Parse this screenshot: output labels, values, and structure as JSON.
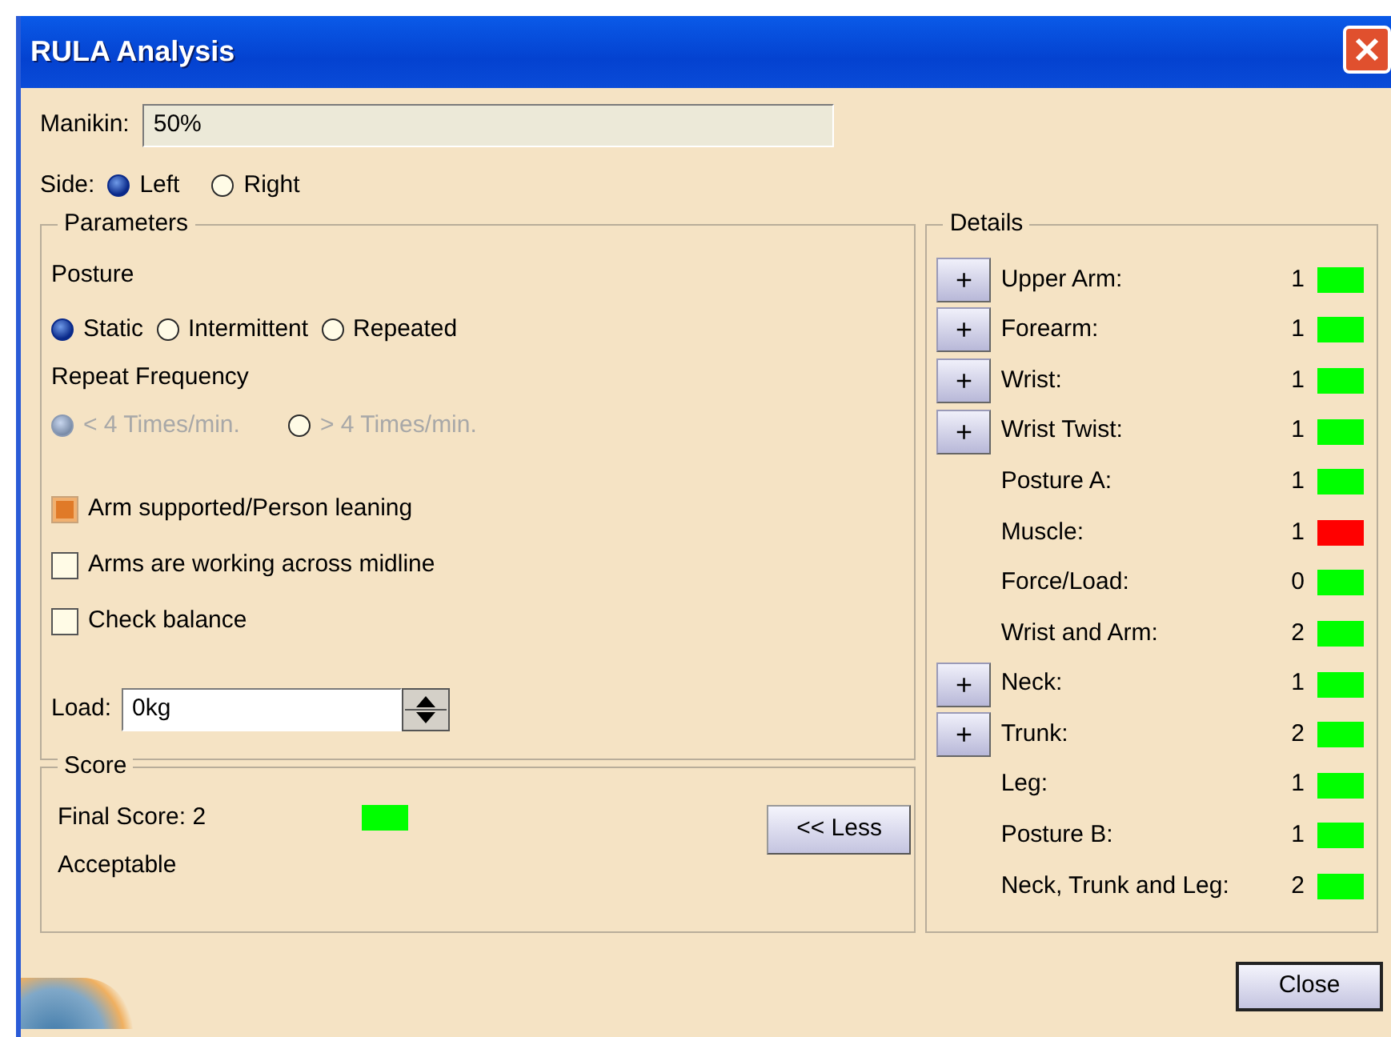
{
  "window": {
    "title": "RULA Analysis"
  },
  "manikin": {
    "label": "Manikin:",
    "value": "50%"
  },
  "side": {
    "label": "Side:",
    "options": [
      {
        "label": "Left",
        "selected": true
      },
      {
        "label": "Right",
        "selected": false
      }
    ]
  },
  "parameters": {
    "title": "Parameters",
    "posture": {
      "label": "Posture",
      "options": [
        {
          "label": "Static",
          "selected": true
        },
        {
          "label": "Intermittent",
          "selected": false
        },
        {
          "label": "Repeated",
          "selected": false
        }
      ]
    },
    "repeat_frequency": {
      "label": "Repeat Frequency",
      "disabled": true,
      "options": [
        {
          "label": "< 4 Times/min.",
          "selected": true
        },
        {
          "label": "> 4 Times/min.",
          "selected": false
        }
      ]
    },
    "checkboxes": [
      {
        "label": "Arm supported/Person leaning",
        "checked": true
      },
      {
        "label": "Arms are working across midline",
        "checked": false
      },
      {
        "label": "Check balance",
        "checked": false
      }
    ],
    "load": {
      "label": "Load:",
      "value": "0kg"
    }
  },
  "score": {
    "title": "Score",
    "final_score": "Final Score: 2",
    "color": "#00ff00",
    "verdict": "Acceptable",
    "less_button": "<< Less"
  },
  "details": {
    "title": "Details",
    "rows": [
      {
        "label": "Upper Arm:",
        "value": "1",
        "color": "#00ff00",
        "button": "+"
      },
      {
        "label": "Forearm:",
        "value": "1",
        "color": "#00ff00",
        "button": "+"
      },
      {
        "label": "Wrist:",
        "value": "1",
        "color": "#00ff00",
        "button": "+"
      },
      {
        "label": "Wrist Twist:",
        "value": "1",
        "color": "#00ff00",
        "button": "+"
      },
      {
        "label": "Posture A:",
        "value": "1",
        "color": "#00ff00"
      },
      {
        "label": "Muscle:",
        "value": "1",
        "color": "#ff0000"
      },
      {
        "label": "Force/Load:",
        "value": "0",
        "color": "#00ff00"
      },
      {
        "label": "Wrist and Arm:",
        "value": "2",
        "color": "#00ff00"
      },
      {
        "label": "Neck:",
        "value": "1",
        "color": "#00ff00",
        "button": "+"
      },
      {
        "label": "Trunk:",
        "value": "2",
        "color": "#00ff00",
        "button": "+"
      },
      {
        "label": "Leg:",
        "value": "1",
        "color": "#00ff00"
      },
      {
        "label": "Posture B:",
        "value": "1",
        "color": "#00ff00"
      },
      {
        "label": "Neck, Trunk and Leg:",
        "value": "2",
        "color": "#00ff00"
      }
    ]
  },
  "close_button": "Close"
}
